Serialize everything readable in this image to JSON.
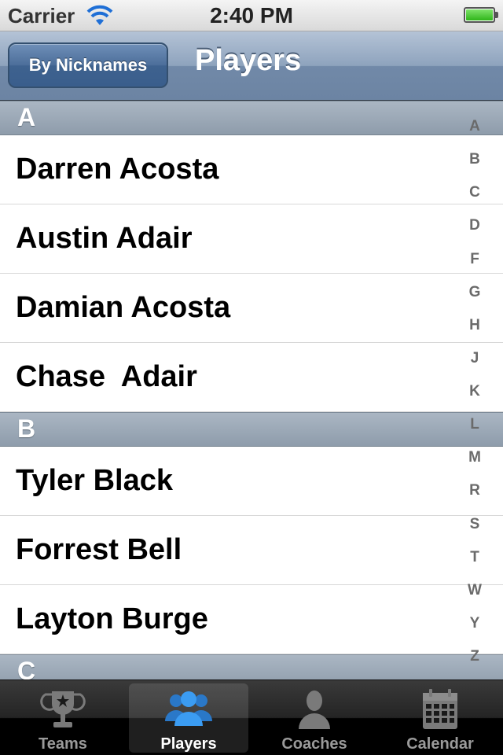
{
  "status_bar": {
    "carrier": "Carrier",
    "time": "2:40 PM",
    "battery_level": 1.0,
    "battery_color": "#2fb51a"
  },
  "nav_bar": {
    "left_button": "By Nicknames",
    "title": "Players"
  },
  "sections": [
    {
      "header": "A",
      "rows": [
        "Darren Acosta",
        "Austin Adair",
        "Damian Acosta",
        "Chase  Adair"
      ]
    },
    {
      "header": "B",
      "rows": [
        "Tyler Black",
        "Forrest Bell",
        "Layton Burge"
      ]
    },
    {
      "header": "C",
      "rows": []
    }
  ],
  "index": [
    "A",
    "B",
    "C",
    "D",
    "F",
    "G",
    "H",
    "J",
    "K",
    "L",
    "M",
    "R",
    "S",
    "T",
    "W",
    "Y",
    "Z"
  ],
  "tab_bar": {
    "tabs": [
      {
        "label": "Teams",
        "icon": "trophy-icon",
        "selected": false
      },
      {
        "label": "Players",
        "icon": "players-icon",
        "selected": true
      },
      {
        "label": "Coaches",
        "icon": "coach-icon",
        "selected": false
      },
      {
        "label": "Calendar",
        "icon": "calendar-icon",
        "selected": false
      }
    ],
    "selected_color": "#3b9cf2"
  }
}
